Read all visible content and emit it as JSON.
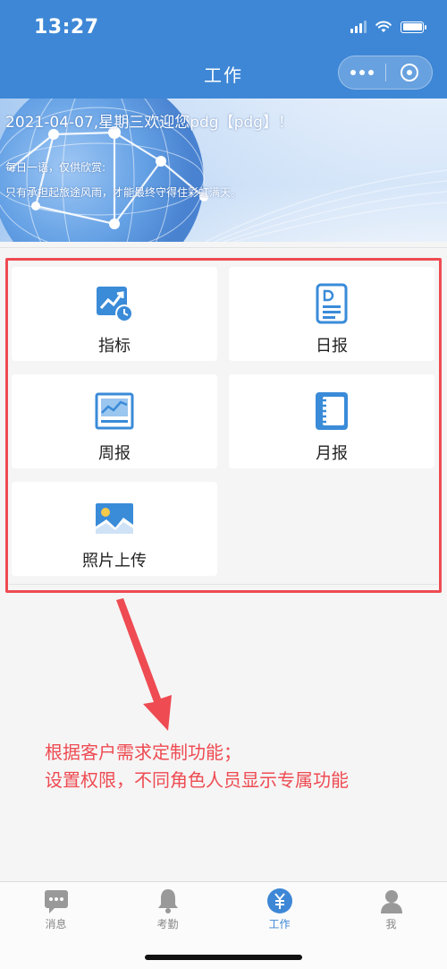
{
  "status_bar": {
    "time": "13:27"
  },
  "nav": {
    "title": "工作",
    "more_icon": "more-dots-icon",
    "close_icon": "target-close-icon"
  },
  "banner": {
    "greeting": "2021-04-07,星期三欢迎您pdg【pdg】！",
    "daily_title": "每日一语，仅供欣赏:",
    "daily_quote": "只有承担起旅途风雨，才能最终守得住彩虹满天。"
  },
  "tiles": [
    {
      "label": "指标",
      "icon": "chart-clock-icon"
    },
    {
      "label": "日报",
      "icon": "daily-report-icon"
    },
    {
      "label": "周报",
      "icon": "weekly-chart-icon"
    },
    {
      "label": "月报",
      "icon": "notebook-icon"
    },
    {
      "label": "照片上传",
      "icon": "photo-icon"
    }
  ],
  "annotation": {
    "line1": "根据客户需求定制功能；",
    "line2": "设置权限，不同角色人员显示专属功能",
    "color": "#ee4b52"
  },
  "tabbar": {
    "items": [
      {
        "label": "消息",
        "icon": "message-icon",
        "active": false
      },
      {
        "label": "考勤",
        "icon": "bell-icon",
        "active": false
      },
      {
        "label": "工作",
        "icon": "work-yuan-icon",
        "active": true
      },
      {
        "label": "我",
        "icon": "user-icon",
        "active": false
      }
    ]
  },
  "colors": {
    "primary": "#3e87d6",
    "accent": "#ee4b52",
    "icon_blue": "#3a8bd8"
  }
}
